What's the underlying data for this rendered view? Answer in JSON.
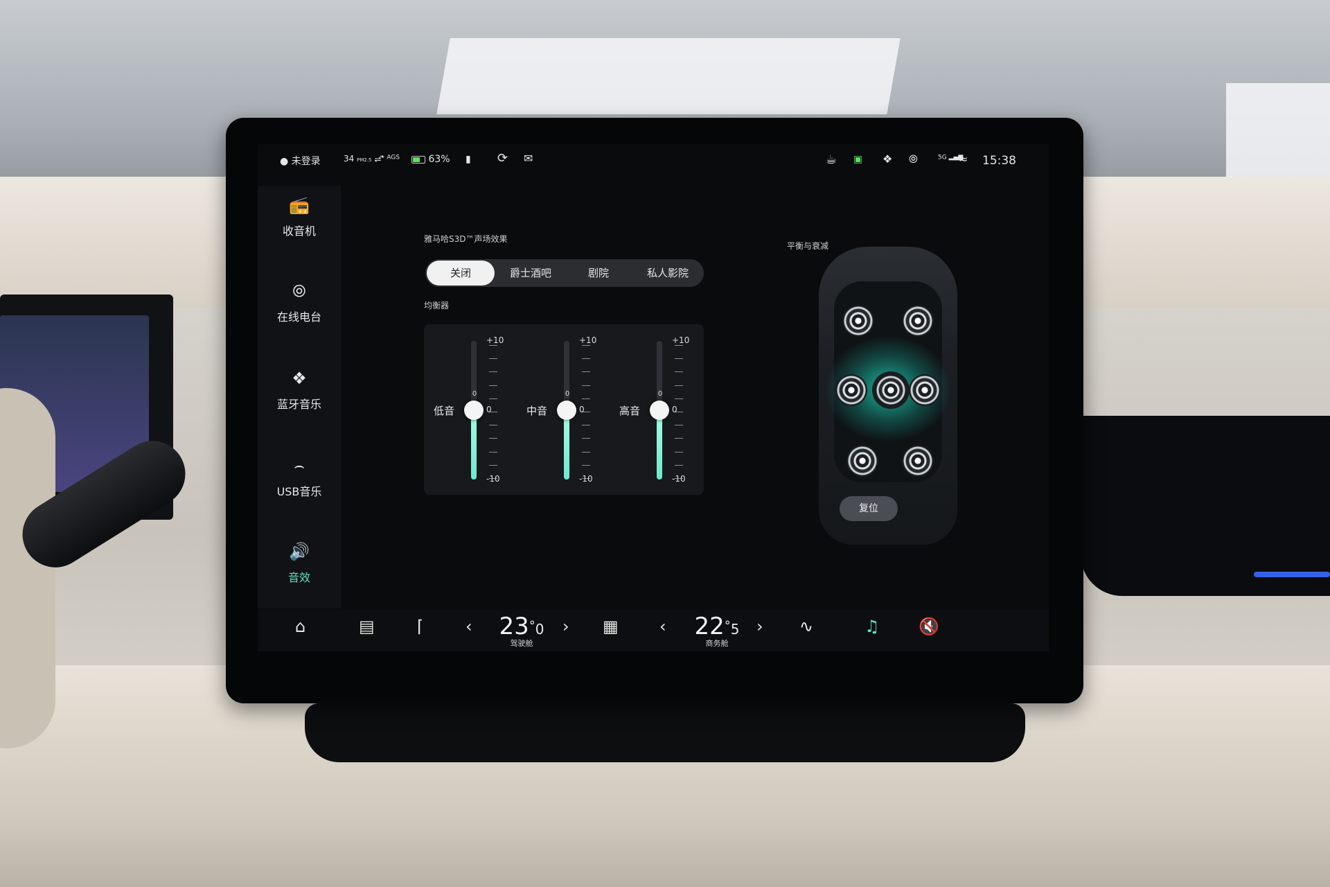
{
  "status": {
    "user_label": "未登录",
    "pm25_value": "34",
    "pm25_unit": "PM2.5",
    "ags_label": "AGS",
    "battery_percent": "63%",
    "clock": "15:38",
    "network": "5G"
  },
  "sidebar": {
    "items": [
      {
        "label": "收音机",
        "icon": "radio-icon"
      },
      {
        "label": "在线电台",
        "icon": "podcast-icon"
      },
      {
        "label": "蓝牙音乐",
        "icon": "bluetooth-icon"
      },
      {
        "label": "USB音乐",
        "icon": "usb-icon"
      },
      {
        "label": "音效",
        "icon": "speaker-icon",
        "active": true
      }
    ]
  },
  "sound_effect": {
    "title": "雅马哈S3D™声场效果",
    "options": [
      "关闭",
      "爵士酒吧",
      "剧院",
      "私人影院"
    ],
    "selected": "关闭"
  },
  "equalizer": {
    "title": "均衡器",
    "range_max_label": "+10",
    "range_mid_label": "0",
    "range_min_label": "-10",
    "top_zero_label": "0",
    "bands": [
      {
        "name": "低音",
        "value": 0
      },
      {
        "name": "中音",
        "value": 0
      },
      {
        "name": "高音",
        "value": 0
      }
    ]
  },
  "balance": {
    "title": "平衡与衰减",
    "reset_label": "复位"
  },
  "climate": {
    "driver": {
      "temp_int": "23",
      "temp_dec": "0",
      "unit": "°",
      "label": "驾驶舱"
    },
    "passenger": {
      "temp_int": "22",
      "temp_dec": "5",
      "unit": "°",
      "label": "商务舱"
    }
  },
  "colors": {
    "accent": "#5ce3c5",
    "screen_bg": "#0a0b0d"
  }
}
